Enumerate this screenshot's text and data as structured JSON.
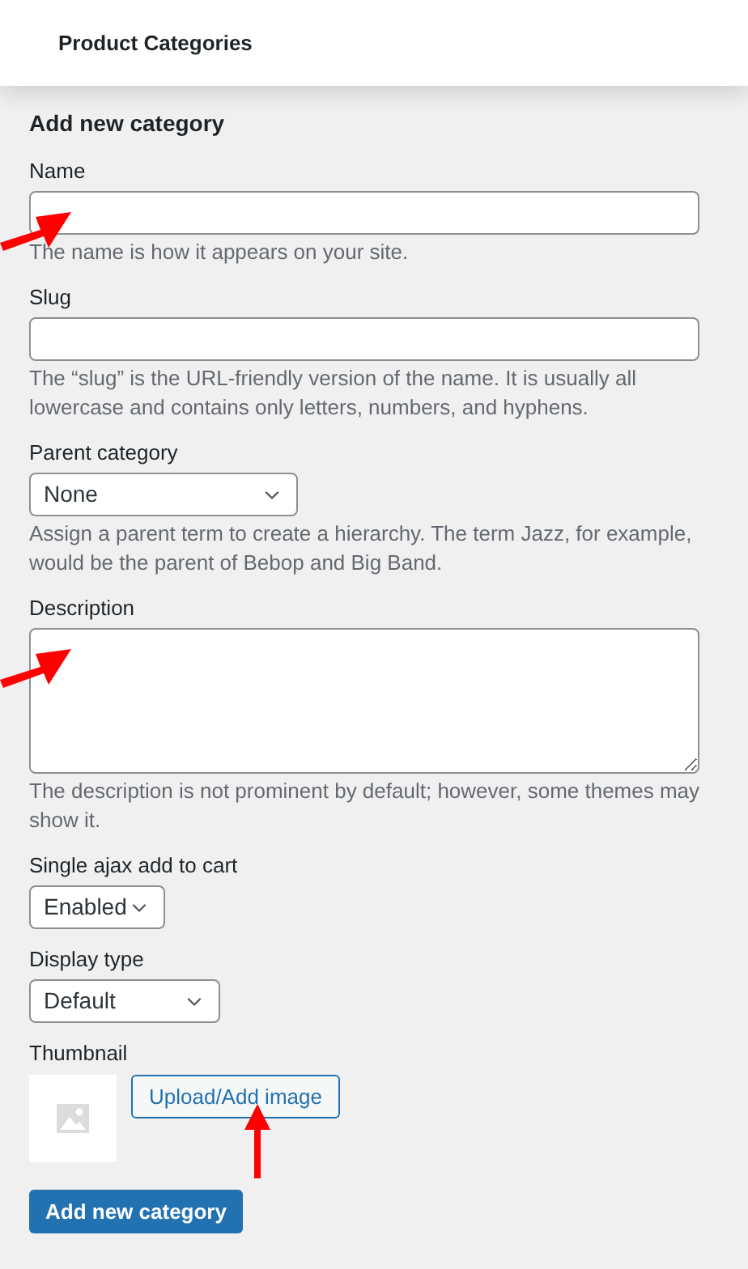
{
  "header": {
    "title": "Product Categories"
  },
  "form": {
    "heading": "Add new category",
    "fields": [
      {
        "kind": "text",
        "label": "Name",
        "help": "The name is how it appears on your site.",
        "annotated": true
      },
      {
        "kind": "text",
        "label": "Slug",
        "help": "The “slug” is the URL-friendly version of the name. It is usually all lowercase and contains only letters, numbers, and hyphens.",
        "annotated": false
      },
      {
        "kind": "select",
        "label": "Parent category",
        "value": "None",
        "help": "Assign a parent term to create a hierarchy. The term Jazz, for example, would be the parent of Bebop and Big Band.",
        "annotated": false
      },
      {
        "kind": "textarea",
        "label": "Description",
        "help": "The description is not prominent by default; however, some themes may show it.",
        "annotated": true
      },
      {
        "kind": "select",
        "label": "Single ajax add to cart",
        "value": "Enabled",
        "annotated": false
      },
      {
        "kind": "select",
        "label": "Display type",
        "value": "Default",
        "annotated": false
      },
      {
        "kind": "thumbnail",
        "label": "Thumbnail",
        "button": "Upload/Add image",
        "annotated": true
      }
    ],
    "submit": "Add new category"
  }
}
